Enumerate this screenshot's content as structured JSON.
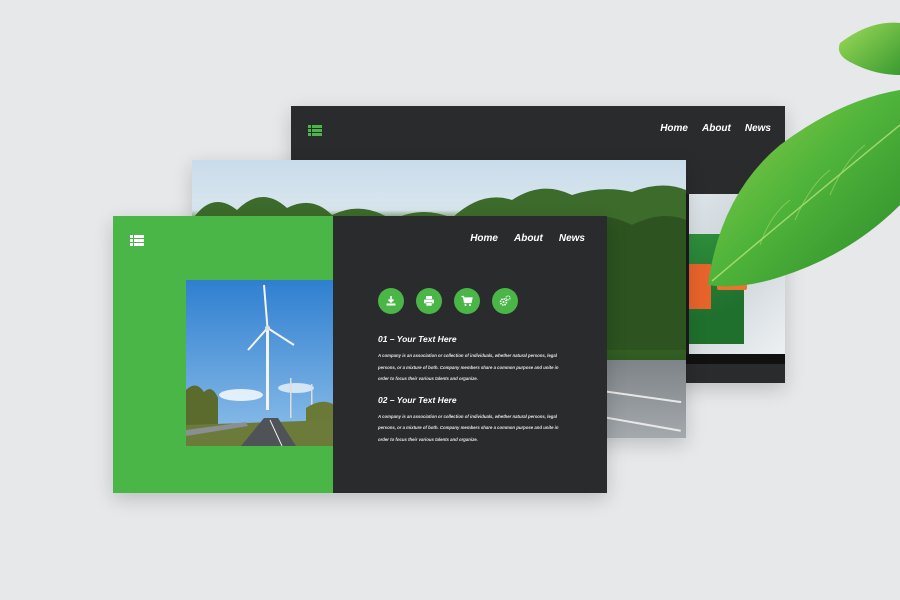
{
  "back_slide": {
    "nav": [
      "Home",
      "About",
      "News"
    ]
  },
  "front_slide": {
    "nav": [
      "Home",
      "About",
      "News"
    ],
    "action_icons": [
      "download-icon",
      "print-icon",
      "cart-icon",
      "settings-icon"
    ],
    "sections": [
      {
        "title": "01 – Your Text Here",
        "body": "A company is an association or collection of individuals, whether natural persons, legal persons, or a mixture of both. Company members share a common purpose and unite in order to focus their various talents and organize."
      },
      {
        "title": "02 – Your Text Here",
        "body": "A company is an association or collection of individuals, whether natural persons, legal persons, or a mixture of both. Company members share a common purpose and unite in order to focus their various talents and organize."
      }
    ]
  },
  "colors": {
    "accent": "#4ab648",
    "dark": "#2a2b2c",
    "background": "#e6e8ea"
  }
}
